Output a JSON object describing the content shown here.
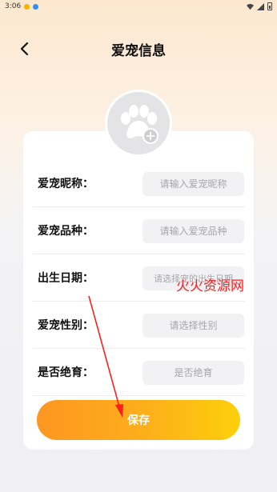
{
  "status_bar": {
    "time": "3:06",
    "dot_colors": [
      "#f5b400",
      "#2f8ff3"
    ]
  },
  "header": {
    "title": "爱宠信息",
    "back_icon": "chevron-left-icon"
  },
  "avatar": {
    "icon": "paw-icon",
    "add_icon": "plus-icon"
  },
  "form": {
    "rows": [
      {
        "label": "爱宠昵称：",
        "placeholder": "请输入爱宠昵称",
        "value": ""
      },
      {
        "label": "爱宠品种：",
        "placeholder": "请输入爱宠品种",
        "value": ""
      },
      {
        "label": "出生日期：",
        "placeholder": "请选择宠的出生日期",
        "value": ""
      },
      {
        "label": "爱宠性别：",
        "placeholder": "请选择性别",
        "value": ""
      },
      {
        "label": "是否绝育：",
        "placeholder": "是否绝育",
        "value": ""
      }
    ]
  },
  "save_button": {
    "label": "保存"
  },
  "watermark": "火火资源网",
  "colors": {
    "accent_start": "#fd9622",
    "accent_end": "#fcd00b",
    "annotation_red": "#ff1e1e"
  }
}
